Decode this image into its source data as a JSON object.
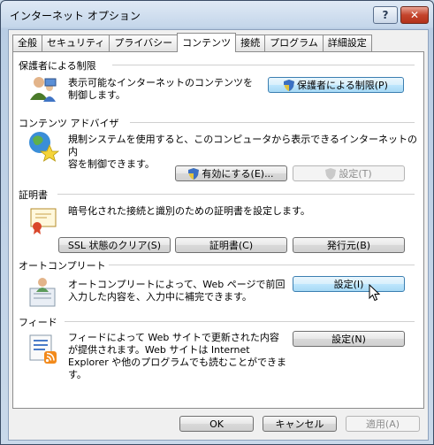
{
  "window": {
    "title": "インターネット オプション",
    "help_label": "?",
    "close_label": "✕"
  },
  "tabs": [
    {
      "label": "全般"
    },
    {
      "label": "セキュリティ"
    },
    {
      "label": "プライバシー"
    },
    {
      "label": "コンテンツ"
    },
    {
      "label": "接続"
    },
    {
      "label": "プログラム"
    },
    {
      "label": "詳細設定"
    }
  ],
  "active_tab": "コンテンツ",
  "parental": {
    "title": "保護者による制限",
    "description_1": "表示可能なインターネットのコンテンツを",
    "description_2": "制御します。",
    "button": "保護者による制限(P)"
  },
  "advisor": {
    "title": "コンテンツ アドバイザ",
    "description_1": "規制システムを使用すると、このコンピュータから表示できるインターネットの内",
    "description_2": "容を制御できます。",
    "enable_button": "有効にする(E)...",
    "settings_button": "設定(T)"
  },
  "certificates": {
    "title": "証明書",
    "description": "暗号化された接続と識別のための証明書を設定します。",
    "ssl_button": "SSL 状態のクリア(S)",
    "cert_button": "証明書(C)",
    "publishers_button": "発行元(B)"
  },
  "autocomplete": {
    "title": "オートコンプリート",
    "description_1": "オートコンプリートによって、Web ページで前回",
    "description_2": "入力した内容を、入力中に補完できます。",
    "settings_button": "設定(I)"
  },
  "feeds": {
    "title": "フィード",
    "description_1": "フィードによって Web サイトで更新された内容",
    "description_2": "が提供されます。Web サイトは Internet",
    "description_3": "Explorer や他のプログラムでも読むことができま",
    "description_4": "す。",
    "settings_button": "設定(N)"
  },
  "footer": {
    "ok": "OK",
    "cancel": "キャンセル",
    "apply": "適用(A)"
  },
  "colors": {
    "accent_focus": "#3c7fb1",
    "close_red": "#c4442c"
  }
}
